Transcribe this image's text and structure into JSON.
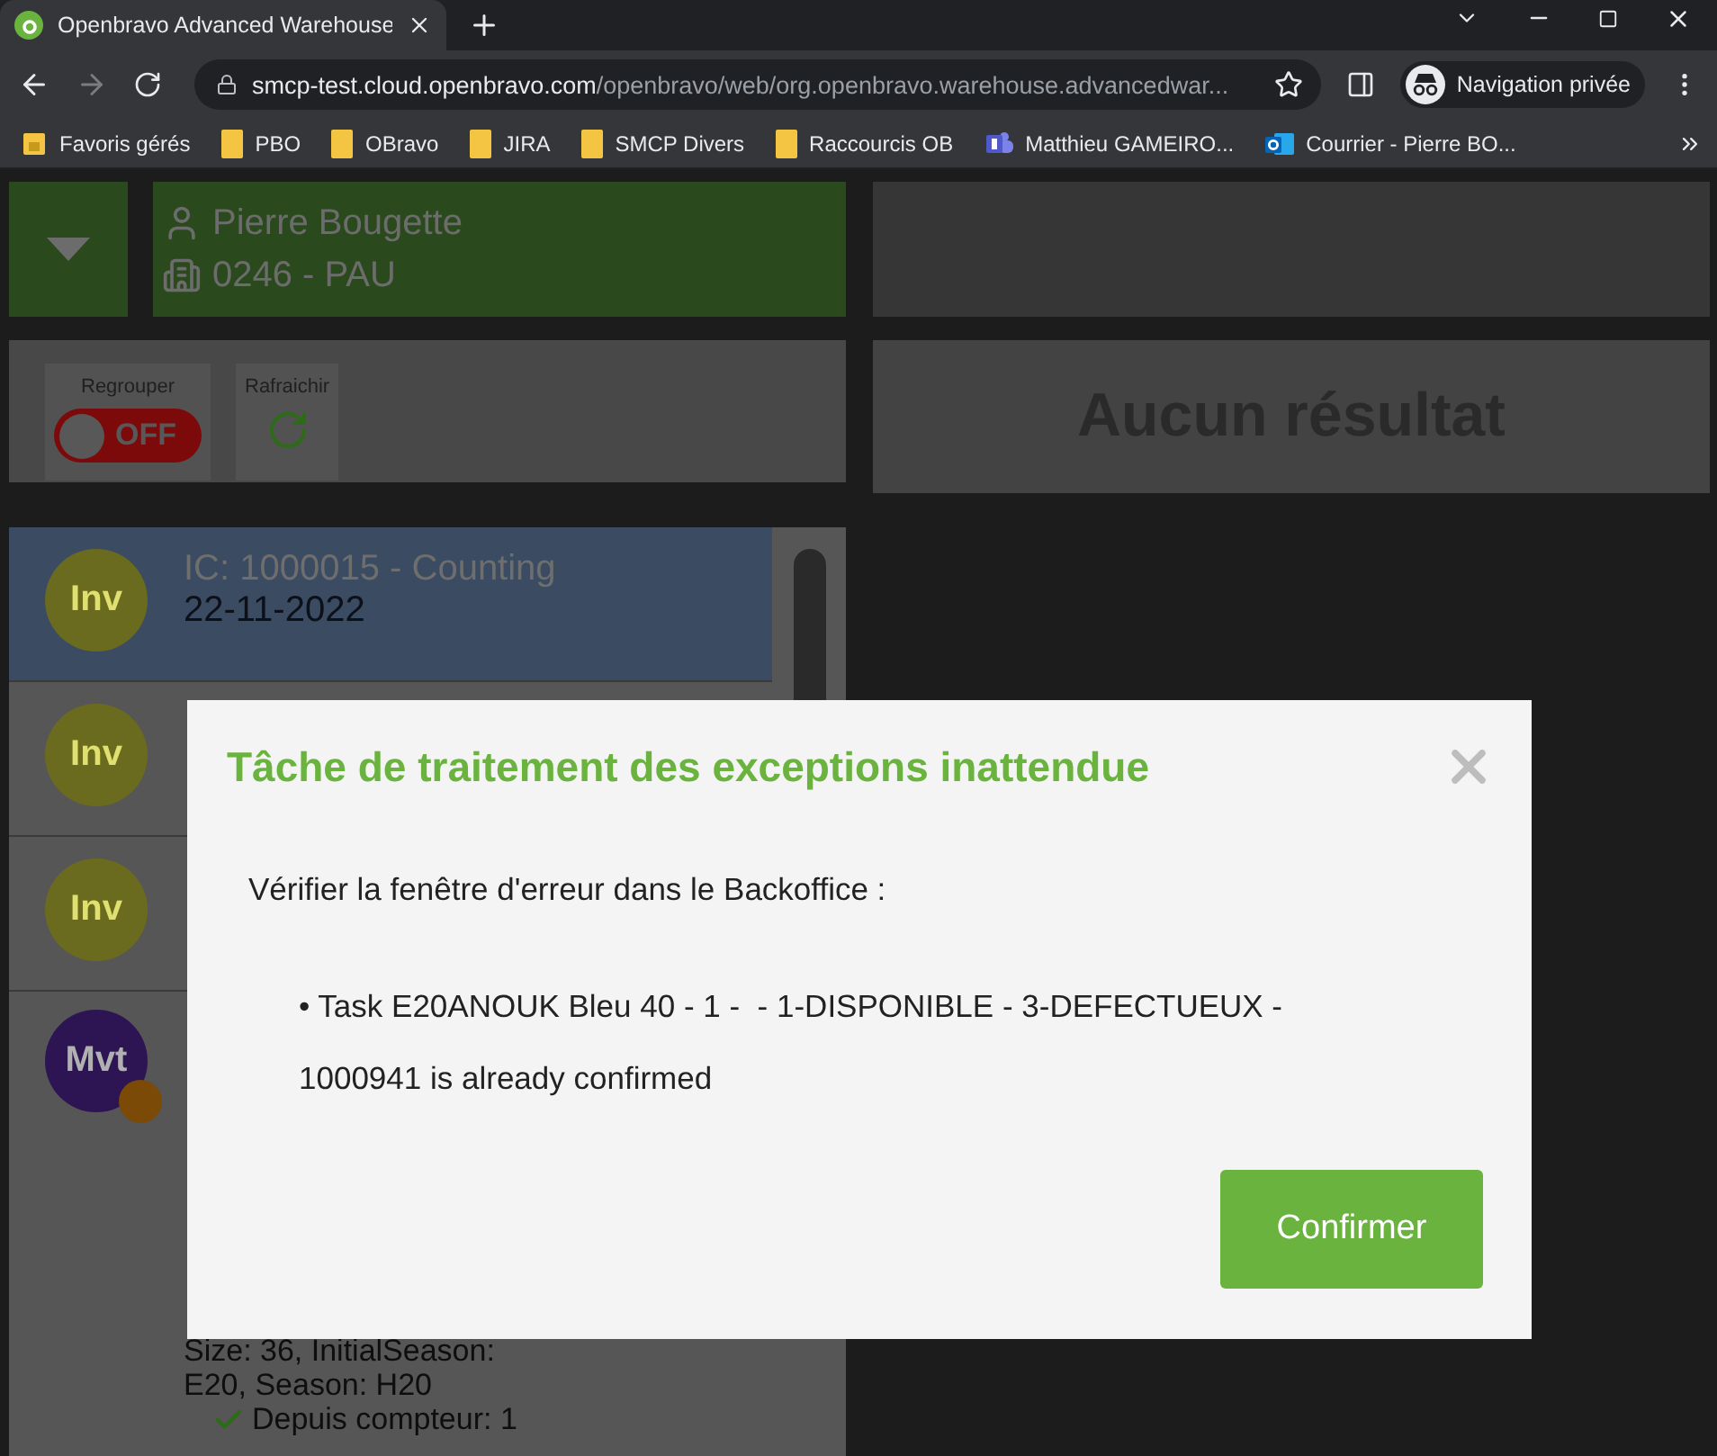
{
  "browser": {
    "tabs": [
      {
        "title": "Openbravo Advanced Warehouse",
        "selected": true
      }
    ],
    "address": {
      "host": "smcp-test.cloud.openbravo.com",
      "path": "/openbravo/web/org.openbravo.warehouse.advancedwar..."
    },
    "profile": "Navigation privée",
    "bookmarks": [
      {
        "label": "Favoris gérés",
        "kind": "managed"
      },
      {
        "label": "PBO",
        "kind": "folder"
      },
      {
        "label": "OBravo",
        "kind": "folder"
      },
      {
        "label": "JIRA",
        "kind": "folder"
      },
      {
        "label": "SMCP Divers",
        "kind": "folder"
      },
      {
        "label": "Raccourcis OB",
        "kind": "folder"
      },
      {
        "label": "Matthieu GAMEIRO...",
        "kind": "teams"
      },
      {
        "label": "Courrier - Pierre BO...",
        "kind": "outlook"
      }
    ]
  },
  "header": {
    "user": "Pierre Bougette",
    "store": "0246 - PAU"
  },
  "toolbar": {
    "group": {
      "label": "Regrouper",
      "state": "OFF",
      "on": false
    },
    "refresh": {
      "label": "Rafraichir"
    }
  },
  "results": {
    "message": "Aucun résultat"
  },
  "tasks": [
    {
      "avatar": "Inv",
      "color": "#6b6b1f",
      "selected": true,
      "title": "IC: 1000015 - Counting",
      "date": "22-11-2022"
    },
    {
      "avatar": "Inv",
      "color": "#6b6b1f",
      "selected": false
    },
    {
      "avatar": "Inv",
      "color": "#6b6b1f",
      "selected": false
    },
    {
      "avatar": "Mvt",
      "color": "#2d1452",
      "selected": false,
      "flagged": true,
      "lines": [
        "Size: 36, InitialSeason:",
        "E20, Season: H20"
      ],
      "footer": "Depuis compteur: 1"
    }
  ],
  "dialog": {
    "title": "Tâche de traitement des exceptions inattendue",
    "message": "Vérifier la fenêtre d'erreur dans le Backoffice :",
    "items": [
      "• Task E20ANOUK Bleu 40 - 1 -  - 1-DISPONIBLE - 3-DEFECTUEUX - 1000941 is already confirmed"
    ],
    "confirm": "Confirmer"
  }
}
